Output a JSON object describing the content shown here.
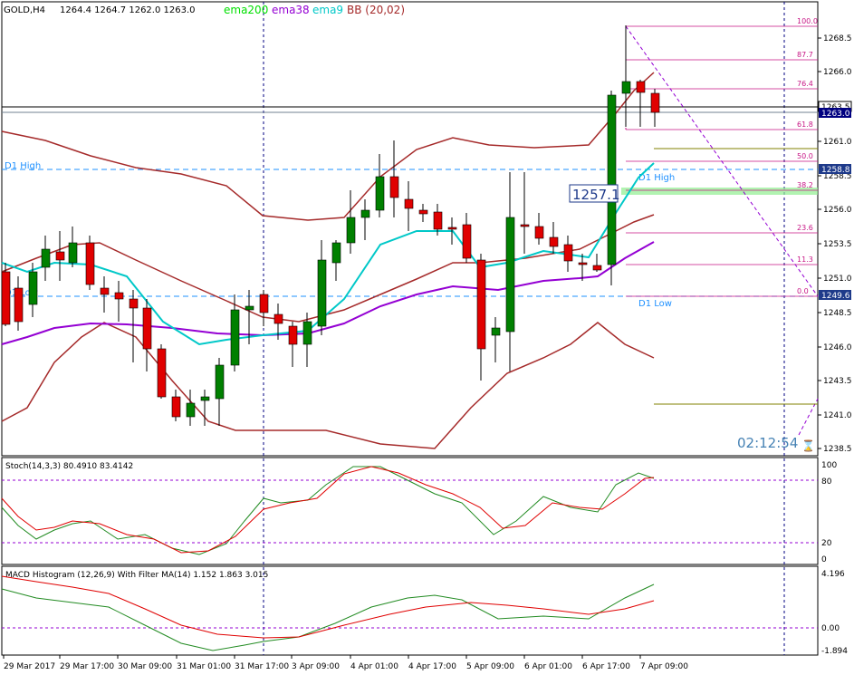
{
  "header": {
    "symbol": "GOLD,H4",
    "ohlc": "1264.4 1264.7 1262.0 1263.0"
  },
  "indicators": [
    {
      "label": "ema200",
      "color": "#00e000"
    },
    {
      "label": "ema38",
      "color": "#9400d3"
    },
    {
      "label": "ema9",
      "color": "#00c8c8"
    },
    {
      "label": "BB (20,02)",
      "color": "#a52a2a"
    }
  ],
  "price_axis": {
    "ticks": [
      "1268.5",
      "1266.0",
      "1263.5",
      "1261.0",
      "1258.5",
      "1256.0",
      "1253.5",
      "1251.0",
      "1248.5",
      "1246.0",
      "1243.5",
      "1241.0",
      "1238.5"
    ],
    "price_box": "1263.0",
    "bid_box": "1263.5",
    "d1_high_box": "1258.8",
    "d1_low_box": "1249.6"
  },
  "levels": {
    "d1_high": "D1 High",
    "d1_low": "D1 Low"
  },
  "fibonacci": [
    "100.0",
    "87.7",
    "76.4",
    "61.8",
    "50.0",
    "38.2",
    "23.6",
    "11.3",
    "0.0"
  ],
  "annotations": {
    "price_label": "1257.1",
    "countdown": "02:12:54"
  },
  "stochastic": {
    "header": "Stoch(14,3,3) 80.4910 83.4142",
    "ticks": [
      "100",
      "80",
      "20",
      "0"
    ]
  },
  "macd": {
    "header": "MACD Histogram (12,26,9) With Filter MA(14) 1.152 1.863 3.015",
    "ticks": [
      "4.196",
      "0.00",
      "-1.894"
    ]
  },
  "time_axis": [
    "29 Mar 2017",
    "29 Mar 17:00",
    "30 Mar 09:00",
    "31 Mar 01:00",
    "31 Mar 17:00",
    "3 Apr 09:00",
    "4 Apr 01:00",
    "4 Apr 17:00",
    "5 Apr 09:00",
    "6 Apr 01:00",
    "6 Apr 17:00",
    "7 Apr 09:00"
  ],
  "colors": {
    "bull": "#008000",
    "bear": "#e00000",
    "grid": "#000000",
    "fib": "#c71585",
    "level": "#1e90ff"
  }
}
